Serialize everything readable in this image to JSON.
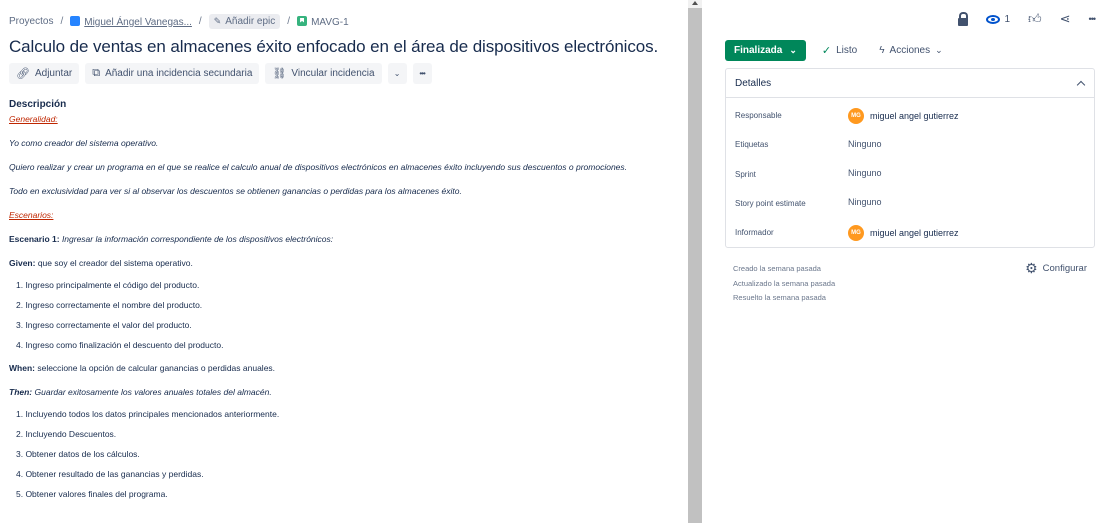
{
  "breadcrumb": {
    "projects": "Proyectos",
    "project": "Miguel Ángel Vanegas...",
    "add_epic": "Añadir epic",
    "issue_key": "MAVG-1"
  },
  "issue": {
    "title": "Calculo de ventas en almacenes éxito enfocado en el área de dispositivos electrónicos."
  },
  "toolbar": {
    "attach": "Adjuntar",
    "add_child": "Añadir una incidencia secundaria",
    "link_issue": "Vincular incidencia",
    "more": "•••"
  },
  "description": {
    "label": "Descripción",
    "generalidad": "Generalidad:",
    "p1": "Yo como creador del sistema operativo.",
    "p2": "Quiero realizar y crear un programa en el que se realice el calculo anual de dispositivos electrónicos en almacenes éxito incluyendo sus descuentos o promociones.",
    "p3": "Todo en exclusividad para ver si al observar los descuentos se obtienen ganancias o perdidas para los almacenes éxito.",
    "escenarios": "Escenarios:",
    "scenario_label": "Escenario 1:",
    "scenario_text": "Ingresar la información correspondiente de los dispositivos electrónicos:",
    "given_label": "Given:",
    "given_text": "que soy el creador del sistema operativo.",
    "given_items": [
      "1. Ingreso principalmente el código del producto.",
      "2. Ingreso correctamente el nombre del producto.",
      "3. Ingreso correctamente el valor del producto.",
      "4. Ingreso como finalización el descuento del producto."
    ],
    "when_label": "When:",
    "when_text": "seleccione la opción de calcular ganancias o perdidas anuales.",
    "then_label": "Then:",
    "then_text": "Guardar exitosamente los valores anuales totales del almacén.",
    "then_items": [
      "1. Incluyendo todos los datos principales mencionados anteriormente.",
      "2. Incluyendo Descuentos.",
      "3. Obtener datos de los cálculos.",
      "4. Obtener resultado de las ganancias y perdidas.",
      "5. Obtener valores finales del programa."
    ]
  },
  "header_actions": {
    "watchers_count": "1",
    "more": "•••"
  },
  "status": {
    "current": "Finalizada",
    "done_label": "Listo",
    "actions": "Acciones",
    "color": "#00875a"
  },
  "details": {
    "heading": "Detalles",
    "fields": {
      "assignee": "Responsable",
      "labels": "Etiquetas",
      "sprint": "Sprint",
      "story_points": "Story point estimate",
      "reporter": "Informador"
    },
    "values": {
      "assignee": "miguel angel gutierrez",
      "assignee_initials": "MG",
      "labels": "Ninguno",
      "sprint": "Ninguno",
      "story_points": "Ninguno",
      "reporter": "miguel angel gutierrez",
      "reporter_initials": "MG"
    }
  },
  "meta": {
    "created": "Creado la semana pasada",
    "updated": "Actualizado la semana pasada",
    "resolved": "Resuelto la semana pasada",
    "configure": "Configurar"
  }
}
